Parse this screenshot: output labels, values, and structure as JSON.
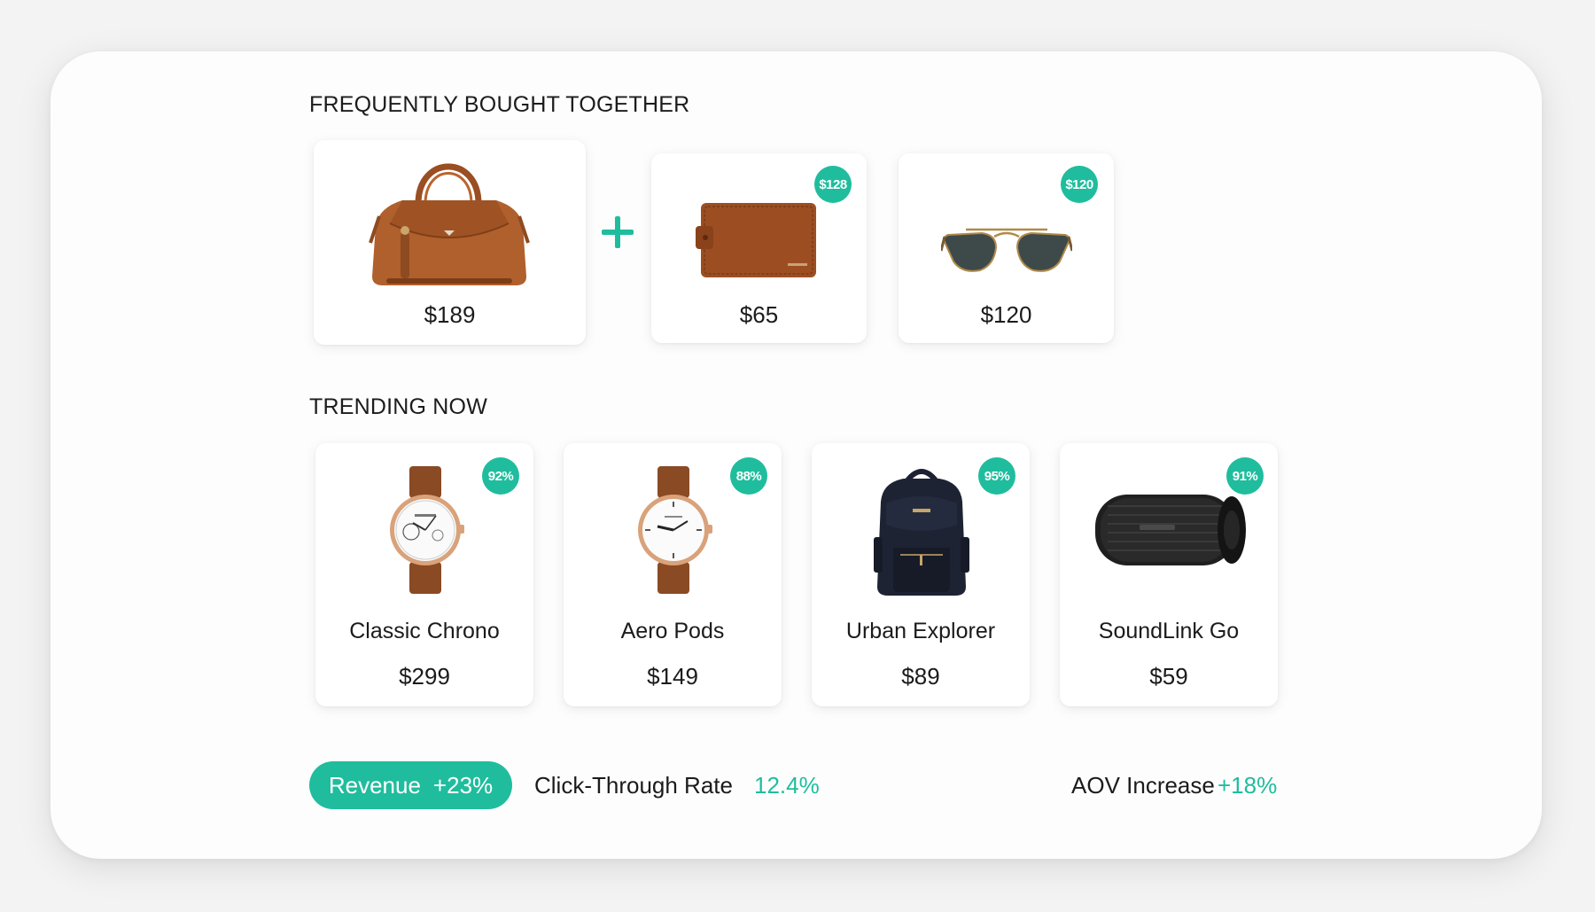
{
  "colors": {
    "accent": "#1fbd9d",
    "panel": "#fdfdfd",
    "background": "#f3f3f3",
    "text": "#1b1b1b"
  },
  "bought_together": {
    "title": "FREQUENTLY BOUGHT TOGETHER",
    "items": [
      {
        "icon": "handbag-icon",
        "price": "$189"
      },
      {
        "icon": "wallet-icon",
        "price": "$65",
        "badge": "$128"
      },
      {
        "icon": "sunglasses-icon",
        "price": "$120",
        "badge": "$120"
      }
    ],
    "plus_icon": "plus-icon"
  },
  "trending": {
    "title": "TRENDING NOW",
    "items": [
      {
        "icon": "chronograph-watch-icon",
        "name": "Classic Chrono",
        "price": "$299",
        "badge": "92%"
      },
      {
        "icon": "watch-icon",
        "name": "Aero Pods",
        "price": "$149",
        "badge": "88%"
      },
      {
        "icon": "backpack-icon",
        "name": "Urban Explorer",
        "price": "$89",
        "badge": "95%"
      },
      {
        "icon": "speaker-icon",
        "name": "SoundLink Go",
        "price": "$59",
        "badge": "91%"
      }
    ]
  },
  "metrics": {
    "revenue_label": "Revenue",
    "revenue_value": "+23%",
    "ctr_label": "Click-Through Rate",
    "ctr_value": "12.4%",
    "aov_label": "AOV Increase",
    "aov_value": "+18%"
  }
}
